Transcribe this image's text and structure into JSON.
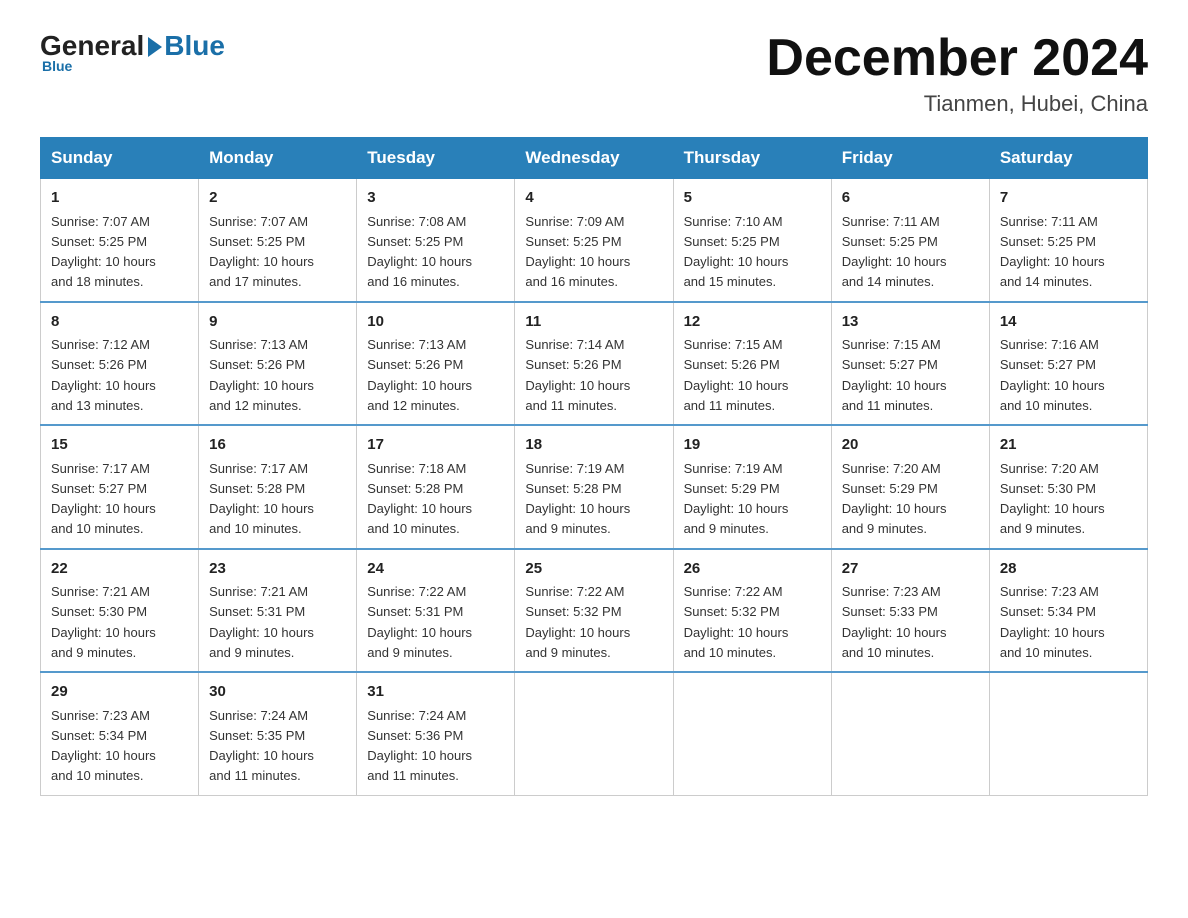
{
  "header": {
    "logo_general": "General",
    "logo_blue": "Blue",
    "month_title": "December 2024",
    "location": "Tianmen, Hubei, China"
  },
  "days_of_week": [
    "Sunday",
    "Monday",
    "Tuesday",
    "Wednesday",
    "Thursday",
    "Friday",
    "Saturday"
  ],
  "weeks": [
    [
      {
        "day": "1",
        "sunrise": "7:07 AM",
        "sunset": "5:25 PM",
        "daylight": "10 hours and 18 minutes."
      },
      {
        "day": "2",
        "sunrise": "7:07 AM",
        "sunset": "5:25 PM",
        "daylight": "10 hours and 17 minutes."
      },
      {
        "day": "3",
        "sunrise": "7:08 AM",
        "sunset": "5:25 PM",
        "daylight": "10 hours and 16 minutes."
      },
      {
        "day": "4",
        "sunrise": "7:09 AM",
        "sunset": "5:25 PM",
        "daylight": "10 hours and 16 minutes."
      },
      {
        "day": "5",
        "sunrise": "7:10 AM",
        "sunset": "5:25 PM",
        "daylight": "10 hours and 15 minutes."
      },
      {
        "day": "6",
        "sunrise": "7:11 AM",
        "sunset": "5:25 PM",
        "daylight": "10 hours and 14 minutes."
      },
      {
        "day": "7",
        "sunrise": "7:11 AM",
        "sunset": "5:25 PM",
        "daylight": "10 hours and 14 minutes."
      }
    ],
    [
      {
        "day": "8",
        "sunrise": "7:12 AM",
        "sunset": "5:26 PM",
        "daylight": "10 hours and 13 minutes."
      },
      {
        "day": "9",
        "sunrise": "7:13 AM",
        "sunset": "5:26 PM",
        "daylight": "10 hours and 12 minutes."
      },
      {
        "day": "10",
        "sunrise": "7:13 AM",
        "sunset": "5:26 PM",
        "daylight": "10 hours and 12 minutes."
      },
      {
        "day": "11",
        "sunrise": "7:14 AM",
        "sunset": "5:26 PM",
        "daylight": "10 hours and 11 minutes."
      },
      {
        "day": "12",
        "sunrise": "7:15 AM",
        "sunset": "5:26 PM",
        "daylight": "10 hours and 11 minutes."
      },
      {
        "day": "13",
        "sunrise": "7:15 AM",
        "sunset": "5:27 PM",
        "daylight": "10 hours and 11 minutes."
      },
      {
        "day": "14",
        "sunrise": "7:16 AM",
        "sunset": "5:27 PM",
        "daylight": "10 hours and 10 minutes."
      }
    ],
    [
      {
        "day": "15",
        "sunrise": "7:17 AM",
        "sunset": "5:27 PM",
        "daylight": "10 hours and 10 minutes."
      },
      {
        "day": "16",
        "sunrise": "7:17 AM",
        "sunset": "5:28 PM",
        "daylight": "10 hours and 10 minutes."
      },
      {
        "day": "17",
        "sunrise": "7:18 AM",
        "sunset": "5:28 PM",
        "daylight": "10 hours and 10 minutes."
      },
      {
        "day": "18",
        "sunrise": "7:19 AM",
        "sunset": "5:28 PM",
        "daylight": "10 hours and 9 minutes."
      },
      {
        "day": "19",
        "sunrise": "7:19 AM",
        "sunset": "5:29 PM",
        "daylight": "10 hours and 9 minutes."
      },
      {
        "day": "20",
        "sunrise": "7:20 AM",
        "sunset": "5:29 PM",
        "daylight": "10 hours and 9 minutes."
      },
      {
        "day": "21",
        "sunrise": "7:20 AM",
        "sunset": "5:30 PM",
        "daylight": "10 hours and 9 minutes."
      }
    ],
    [
      {
        "day": "22",
        "sunrise": "7:21 AM",
        "sunset": "5:30 PM",
        "daylight": "10 hours and 9 minutes."
      },
      {
        "day": "23",
        "sunrise": "7:21 AM",
        "sunset": "5:31 PM",
        "daylight": "10 hours and 9 minutes."
      },
      {
        "day": "24",
        "sunrise": "7:22 AM",
        "sunset": "5:31 PM",
        "daylight": "10 hours and 9 minutes."
      },
      {
        "day": "25",
        "sunrise": "7:22 AM",
        "sunset": "5:32 PM",
        "daylight": "10 hours and 9 minutes."
      },
      {
        "day": "26",
        "sunrise": "7:22 AM",
        "sunset": "5:32 PM",
        "daylight": "10 hours and 10 minutes."
      },
      {
        "day": "27",
        "sunrise": "7:23 AM",
        "sunset": "5:33 PM",
        "daylight": "10 hours and 10 minutes."
      },
      {
        "day": "28",
        "sunrise": "7:23 AM",
        "sunset": "5:34 PM",
        "daylight": "10 hours and 10 minutes."
      }
    ],
    [
      {
        "day": "29",
        "sunrise": "7:23 AM",
        "sunset": "5:34 PM",
        "daylight": "10 hours and 10 minutes."
      },
      {
        "day": "30",
        "sunrise": "7:24 AM",
        "sunset": "5:35 PM",
        "daylight": "10 hours and 11 minutes."
      },
      {
        "day": "31",
        "sunrise": "7:24 AM",
        "sunset": "5:36 PM",
        "daylight": "10 hours and 11 minutes."
      },
      null,
      null,
      null,
      null
    ]
  ],
  "labels": {
    "sunrise": "Sunrise:",
    "sunset": "Sunset:",
    "daylight": "Daylight:"
  }
}
